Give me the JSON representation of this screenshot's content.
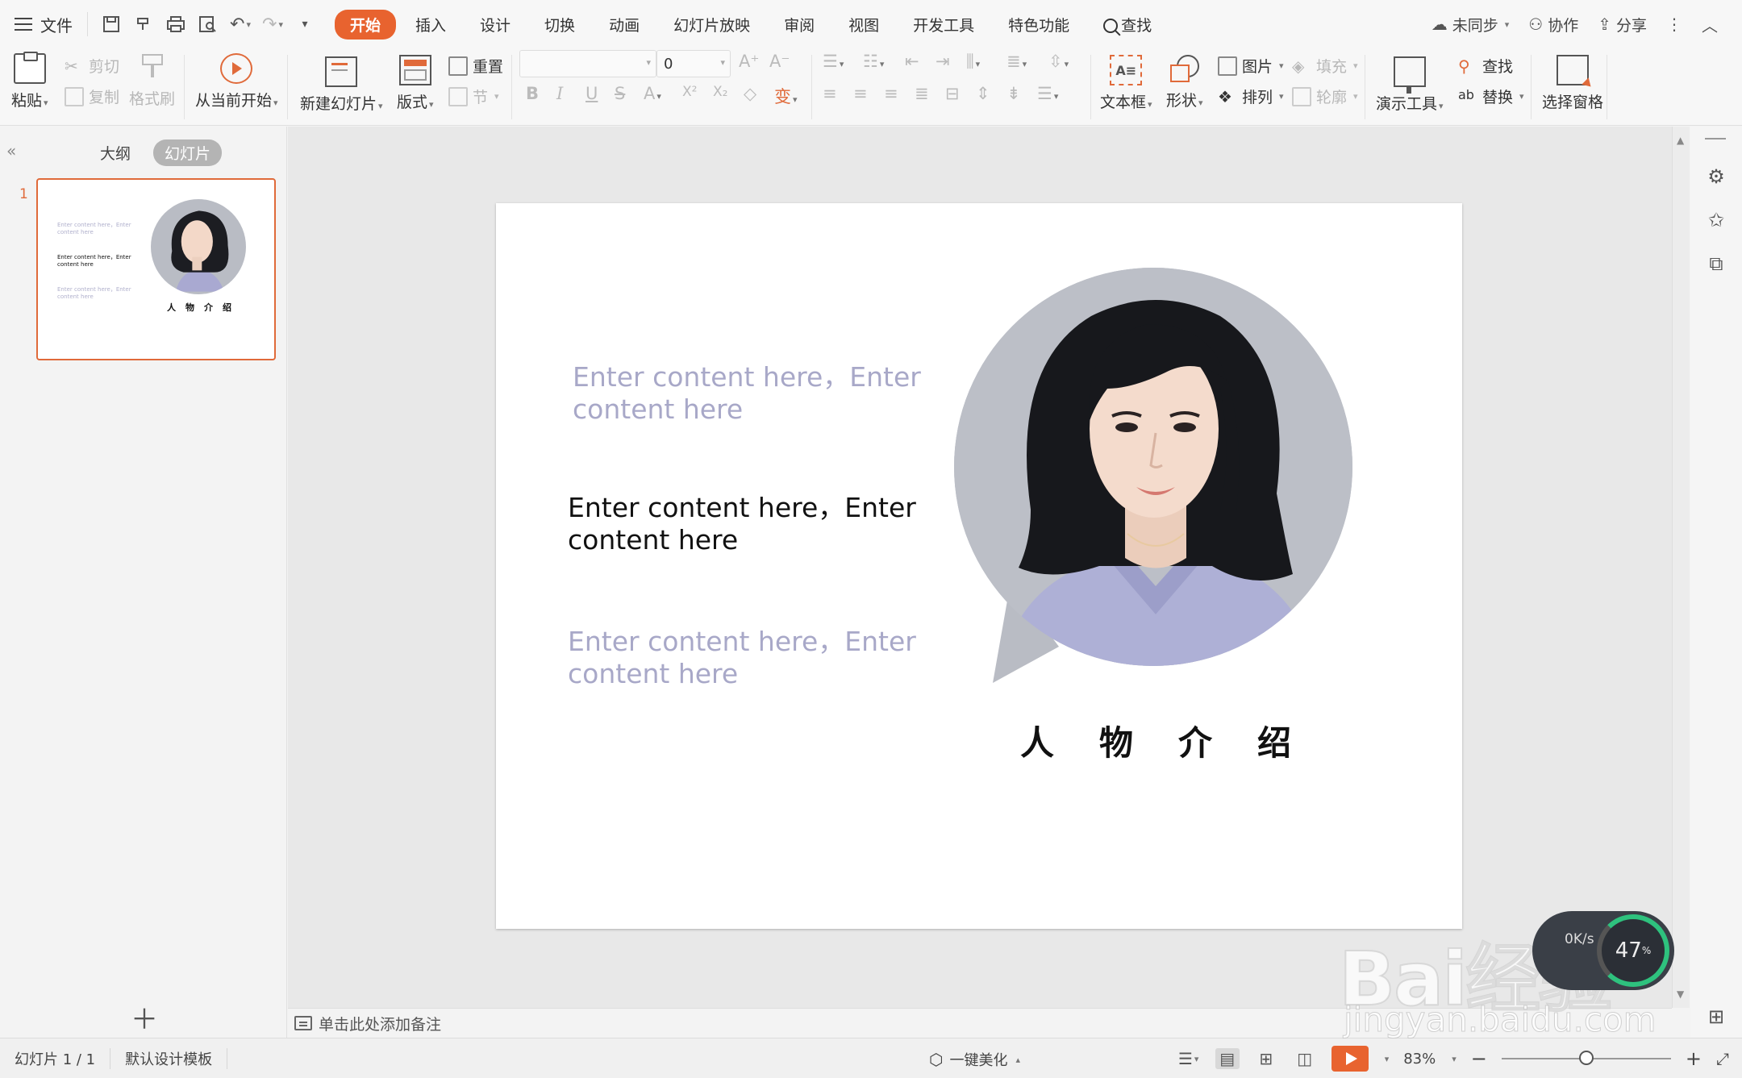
{
  "menu": {
    "file_label": "文件",
    "tabs": [
      "开始",
      "插入",
      "设计",
      "切换",
      "动画",
      "幻灯片放映",
      "审阅",
      "视图",
      "开发工具",
      "特色功能"
    ],
    "active_tab": "开始",
    "search_label": "查找",
    "sync_label": "未同步",
    "collab_label": "协作",
    "share_label": "分享"
  },
  "ribbon": {
    "paste": "粘贴",
    "cut": "剪切",
    "copy": "复制",
    "format_painter": "格式刷",
    "from_current": "从当前开始",
    "new_slide": "新建幻灯片",
    "layout": "版式",
    "reset": "重置",
    "section": "节",
    "font_name": "",
    "font_size": "0",
    "textbox": "文本框",
    "shape": "形状",
    "picture": "图片",
    "fill": "填充",
    "arrange": "排列",
    "outline": "轮廓",
    "present_tools": "演示工具",
    "find": "查找",
    "replace": "替换",
    "select_pane": "选择窗格"
  },
  "left_panel": {
    "tab_outline": "大纲",
    "tab_slides": "幻灯片",
    "active": "幻灯片",
    "slide_number": "1"
  },
  "slide": {
    "text1": "Enter content here，Enter content here",
    "text2": "Enter content here，Enter content here",
    "text3": "Enter content here，Enter content here",
    "title": "人物介绍",
    "colors": {
      "gray_text": "#a8a8c8",
      "dark_text": "#111111",
      "circle_bg": "#b9bcc4",
      "accent": "#e8632f"
    }
  },
  "notes_placeholder": "单击此处添加备注",
  "status": {
    "slide_info": "幻灯片 1 / 1",
    "template": "默认设计模板",
    "beautify": "一键美化",
    "zoom": "83%",
    "zoom_fraction": 0.5
  },
  "watermark": {
    "logo": "Bai经验",
    "url": "jingyan.baidu.com",
    "gauge_value": "47",
    "gauge_speed": "0K/s"
  }
}
